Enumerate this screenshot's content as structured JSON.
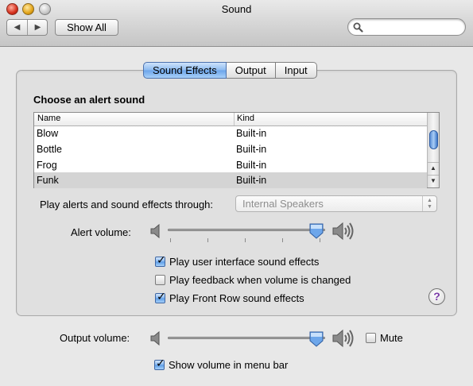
{
  "window": {
    "title": "Sound",
    "controls": [
      "close",
      "minimize",
      "zoom"
    ]
  },
  "toolbar": {
    "back_label": "◀",
    "forward_label": "▶",
    "show_all_label": "Show All",
    "search_value": "",
    "search_placeholder": ""
  },
  "tabs": [
    {
      "label": "Sound Effects",
      "selected": true
    },
    {
      "label": "Output",
      "selected": false
    },
    {
      "label": "Input",
      "selected": false
    }
  ],
  "sound_effects": {
    "section_title": "Choose an alert sound",
    "columns": [
      "Name",
      "Kind"
    ],
    "rows": [
      {
        "name": "Blow",
        "kind": "Built-in",
        "selected": false
      },
      {
        "name": "Bottle",
        "kind": "Built-in",
        "selected": false
      },
      {
        "name": "Frog",
        "kind": "Built-in",
        "selected": false
      },
      {
        "name": "Funk",
        "kind": "Built-in",
        "selected": true
      }
    ],
    "play_through_label": "Play alerts and sound effects through:",
    "play_through_value": "Internal Speakers",
    "alert_volume_label": "Alert volume:",
    "alert_volume_level": 0.93,
    "checkboxes": [
      {
        "label": "Play user interface sound effects",
        "checked": true
      },
      {
        "label": "Play feedback when volume is changed",
        "checked": false
      },
      {
        "label": "Play Front Row sound effects",
        "checked": true
      }
    ],
    "help_label": "?"
  },
  "output": {
    "output_volume_label": "Output volume:",
    "output_volume_level": 0.94,
    "mute_label": "Mute",
    "mute_checked": false,
    "show_volume_label": "Show volume in menu bar",
    "show_volume_checked": true
  },
  "colors": {
    "selection_blue": "#6ba4ea",
    "selected_row": "#d4d4d4",
    "help_purple": "#7a3aa8"
  }
}
